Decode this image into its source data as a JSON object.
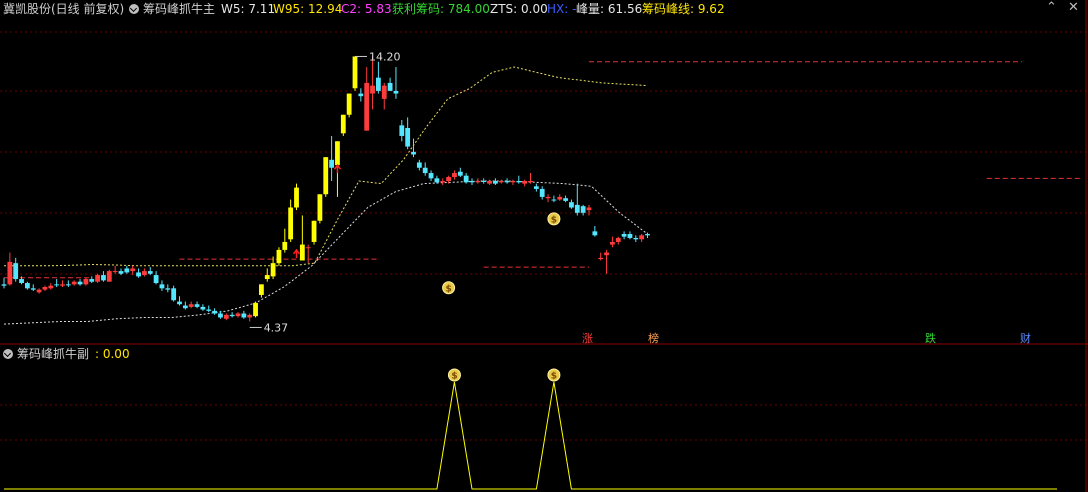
{
  "main_panel": {
    "title": "冀凯股份(日线 前复权)",
    "indicator_name": "筹码峰抓牛主",
    "items": [
      {
        "label": "W5: 7.11",
        "color": "#e6e6e6"
      },
      {
        "label": "W95: 12.94",
        "color": "#ffe600"
      },
      {
        "label": "C2: 5.83",
        "color": "#ff40ff"
      },
      {
        "label": "获利筹码: 784.00",
        "color": "#34d634"
      },
      {
        "label": "ZTS: 0.00",
        "color": "#e6e6e6"
      },
      {
        "label": "HX: -",
        "color": "#3a5cff"
      },
      {
        "label": "峰量: 61.56",
        "color": "#e6e6e6"
      },
      {
        "label": "筹码峰线: 9.62",
        "color": "#ffe600"
      }
    ],
    "price_high_label": "14.20",
    "price_low_label": "4.37",
    "events": [
      {
        "text": "涨",
        "color": "#ff3c3c"
      },
      {
        "text": "榜",
        "color": "#ffa050"
      },
      {
        "text": "跌",
        "color": "#34d634"
      },
      {
        "text": "财",
        "color": "#5a8cff"
      }
    ]
  },
  "sub_panel": {
    "title": "筹码峰抓牛副",
    "value_label": ": 0.00"
  },
  "chart_data": {
    "type": "candlestick",
    "price_range": [
      3.5,
      15.5
    ],
    "up_color": "#ff3c3c",
    "down_color": "#55e6ff",
    "signal_color": "#ffff00",
    "candles": [
      {
        "o": 5.6,
        "h": 5.85,
        "l": 5.45,
        "c": 5.55,
        "k": "d"
      },
      {
        "o": 5.6,
        "h": 6.8,
        "l": 5.55,
        "c": 6.45,
        "k": "u"
      },
      {
        "o": 6.4,
        "h": 6.6,
        "l": 5.7,
        "c": 5.8,
        "k": "d"
      },
      {
        "o": 5.8,
        "h": 5.9,
        "l": 5.6,
        "c": 5.65,
        "k": "d"
      },
      {
        "o": 5.65,
        "h": 5.7,
        "l": 5.4,
        "c": 5.45,
        "k": "d"
      },
      {
        "o": 5.45,
        "h": 5.6,
        "l": 5.35,
        "c": 5.4,
        "k": "d"
      },
      {
        "o": 5.3,
        "h": 5.45,
        "l": 5.25,
        "c": 5.4,
        "k": "u"
      },
      {
        "o": 5.4,
        "h": 5.55,
        "l": 5.35,
        "c": 5.5,
        "k": "u"
      },
      {
        "o": 5.45,
        "h": 5.65,
        "l": 5.4,
        "c": 5.55,
        "k": "u"
      },
      {
        "o": 5.6,
        "h": 5.8,
        "l": 5.5,
        "c": 5.6,
        "k": "d"
      },
      {
        "o": 5.55,
        "h": 5.75,
        "l": 5.5,
        "c": 5.6,
        "k": "u"
      },
      {
        "o": 5.6,
        "h": 5.75,
        "l": 5.5,
        "c": 5.6,
        "k": "d"
      },
      {
        "o": 5.6,
        "h": 5.75,
        "l": 5.55,
        "c": 5.7,
        "k": "u"
      },
      {
        "o": 5.7,
        "h": 5.8,
        "l": 5.55,
        "c": 5.6,
        "k": "d"
      },
      {
        "o": 5.6,
        "h": 5.85,
        "l": 5.55,
        "c": 5.8,
        "k": "u"
      },
      {
        "o": 5.8,
        "h": 5.9,
        "l": 5.65,
        "c": 5.7,
        "k": "d"
      },
      {
        "o": 5.7,
        "h": 6.0,
        "l": 5.65,
        "c": 5.95,
        "k": "u"
      },
      {
        "o": 5.95,
        "h": 6.1,
        "l": 5.7,
        "c": 5.75,
        "k": "d"
      },
      {
        "o": 5.7,
        "h": 6.15,
        "l": 5.7,
        "c": 6.1,
        "k": "u"
      },
      {
        "o": 6.1,
        "h": 6.3,
        "l": 6.0,
        "c": 6.1,
        "k": "u"
      },
      {
        "o": 6.1,
        "h": 6.2,
        "l": 5.95,
        "c": 6.0,
        "k": "d"
      },
      {
        "o": 6.05,
        "h": 6.3,
        "l": 6.0,
        "c": 6.2,
        "k": "d"
      },
      {
        "o": 6.2,
        "h": 6.3,
        "l": 5.95,
        "c": 6.1,
        "k": "u"
      },
      {
        "o": 6.05,
        "h": 6.2,
        "l": 5.85,
        "c": 5.9,
        "k": "d"
      },
      {
        "o": 5.95,
        "h": 6.2,
        "l": 5.9,
        "c": 6.1,
        "k": "u"
      },
      {
        "o": 6.1,
        "h": 6.25,
        "l": 5.95,
        "c": 6.0,
        "k": "d"
      },
      {
        "o": 5.95,
        "h": 6.1,
        "l": 5.6,
        "c": 5.65,
        "k": "d"
      },
      {
        "o": 5.6,
        "h": 5.75,
        "l": 5.35,
        "c": 5.45,
        "k": "d"
      },
      {
        "o": 5.45,
        "h": 5.6,
        "l": 5.3,
        "c": 5.4,
        "k": "d"
      },
      {
        "o": 5.45,
        "h": 5.55,
        "l": 4.95,
        "c": 5.0,
        "k": "d"
      },
      {
        "o": 4.95,
        "h": 5.15,
        "l": 4.8,
        "c": 4.85,
        "k": "d"
      },
      {
        "o": 4.8,
        "h": 4.95,
        "l": 4.65,
        "c": 4.7,
        "k": "d"
      },
      {
        "o": 4.75,
        "h": 4.95,
        "l": 4.7,
        "c": 4.85,
        "k": "u"
      },
      {
        "o": 4.85,
        "h": 4.95,
        "l": 4.7,
        "c": 4.75,
        "k": "d"
      },
      {
        "o": 4.75,
        "h": 4.85,
        "l": 4.6,
        "c": 4.65,
        "k": "d"
      },
      {
        "o": 4.65,
        "h": 4.8,
        "l": 4.55,
        "c": 4.6,
        "k": "d"
      },
      {
        "o": 4.6,
        "h": 4.7,
        "l": 4.45,
        "c": 4.5,
        "k": "d"
      },
      {
        "o": 4.5,
        "h": 4.6,
        "l": 4.3,
        "c": 4.35,
        "k": "d"
      },
      {
        "o": 4.3,
        "h": 4.5,
        "l": 4.25,
        "c": 4.45,
        "k": "u"
      },
      {
        "o": 4.45,
        "h": 4.55,
        "l": 4.35,
        "c": 4.4,
        "k": "d"
      },
      {
        "o": 4.4,
        "h": 4.55,
        "l": 4.35,
        "c": 4.5,
        "k": "u"
      },
      {
        "o": 4.5,
        "h": 4.6,
        "l": 4.3,
        "c": 4.35,
        "k": "d"
      },
      {
        "o": 4.35,
        "h": 4.5,
        "l": 4.2,
        "c": 4.45,
        "k": "u"
      },
      {
        "o": 4.4,
        "h": 4.95,
        "l": 4.35,
        "c": 4.9,
        "k": "s"
      },
      {
        "o": 5.2,
        "h": 5.6,
        "l": 5.1,
        "c": 5.6,
        "k": "s"
      },
      {
        "o": 5.8,
        "h": 6.2,
        "l": 5.7,
        "c": 5.95,
        "k": "s"
      },
      {
        "o": 5.9,
        "h": 6.65,
        "l": 5.8,
        "c": 6.4,
        "k": "s"
      },
      {
        "o": 6.4,
        "h": 7.0,
        "l": 6.3,
        "c": 6.9,
        "k": "s"
      },
      {
        "o": 6.9,
        "h": 7.7,
        "l": 6.8,
        "c": 7.2,
        "k": "s"
      },
      {
        "o": 7.3,
        "h": 8.8,
        "l": 7.2,
        "c": 8.5,
        "k": "s"
      },
      {
        "o": 8.5,
        "h": 9.4,
        "l": 8.4,
        "c": 9.25,
        "k": "s"
      },
      {
        "o": 6.5,
        "h": 8.2,
        "l": 6.5,
        "c": 7.1,
        "k": "s"
      },
      {
        "o": 7.0,
        "h": 7.1,
        "l": 6.4,
        "c": 7.0,
        "k": "u"
      },
      {
        "o": 7.2,
        "h": 8.0,
        "l": 7.1,
        "c": 8.0,
        "k": "s"
      },
      {
        "o": 8.0,
        "h": 9.0,
        "l": 7.9,
        "c": 9.0,
        "k": "s"
      },
      {
        "o": 9.0,
        "h": 10.4,
        "l": 8.9,
        "c": 10.4,
        "k": "s"
      },
      {
        "o": 10.0,
        "h": 11.2,
        "l": 9.5,
        "c": 10.3,
        "k": "d"
      },
      {
        "o": 10.1,
        "h": 11.0,
        "l": 8.9,
        "c": 11.0,
        "k": "s"
      },
      {
        "o": 11.3,
        "h": 12.0,
        "l": 11.2,
        "c": 12.0,
        "k": "s"
      },
      {
        "o": 12.0,
        "h": 12.8,
        "l": 11.9,
        "c": 12.8,
        "k": "s"
      },
      {
        "o": 13.0,
        "h": 14.2,
        "l": 12.9,
        "c": 14.2,
        "k": "s"
      },
      {
        "o": 12.8,
        "h": 13.0,
        "l": 12.5,
        "c": 12.7,
        "k": "d"
      },
      {
        "o": 11.4,
        "h": 13.8,
        "l": 11.4,
        "c": 13.2,
        "k": "u"
      },
      {
        "o": 12.8,
        "h": 14.2,
        "l": 12.2,
        "c": 13.1,
        "k": "u"
      },
      {
        "o": 13.4,
        "h": 14.0,
        "l": 12.8,
        "c": 12.9,
        "k": "d"
      },
      {
        "o": 12.6,
        "h": 13.2,
        "l": 12.2,
        "c": 13.1,
        "k": "u"
      },
      {
        "o": 13.2,
        "h": 13.4,
        "l": 12.9,
        "c": 12.9,
        "k": "d"
      },
      {
        "o": 12.9,
        "h": 13.8,
        "l": 12.6,
        "c": 12.8,
        "k": "d"
      },
      {
        "o": 11.6,
        "h": 11.8,
        "l": 11.0,
        "c": 11.2,
        "k": "d"
      },
      {
        "o": 11.5,
        "h": 11.9,
        "l": 10.7,
        "c": 10.8,
        "k": "d"
      },
      {
        "o": 10.6,
        "h": 11.1,
        "l": 10.4,
        "c": 10.5,
        "k": "d"
      },
      {
        "o": 10.2,
        "h": 10.3,
        "l": 9.9,
        "c": 10.0,
        "k": "d"
      },
      {
        "o": 10.0,
        "h": 10.2,
        "l": 9.7,
        "c": 9.8,
        "k": "d"
      },
      {
        "o": 9.8,
        "h": 9.9,
        "l": 9.5,
        "c": 9.6,
        "k": "d"
      },
      {
        "o": 9.6,
        "h": 9.7,
        "l": 9.4,
        "c": 9.45,
        "k": "d"
      },
      {
        "o": 9.45,
        "h": 9.6,
        "l": 9.35,
        "c": 9.5,
        "k": "u"
      },
      {
        "o": 9.5,
        "h": 9.7,
        "l": 9.4,
        "c": 9.65,
        "k": "u"
      },
      {
        "o": 9.65,
        "h": 9.9,
        "l": 9.55,
        "c": 9.8,
        "k": "u"
      },
      {
        "o": 9.85,
        "h": 10.0,
        "l": 9.65,
        "c": 9.7,
        "k": "d"
      },
      {
        "o": 9.7,
        "h": 9.8,
        "l": 9.4,
        "c": 9.45,
        "k": "d"
      },
      {
        "o": 9.5,
        "h": 9.6,
        "l": 9.35,
        "c": 9.45,
        "k": "d"
      },
      {
        "o": 9.45,
        "h": 9.6,
        "l": 9.4,
        "c": 9.5,
        "k": "u"
      },
      {
        "o": 9.5,
        "h": 9.6,
        "l": 9.4,
        "c": 9.5,
        "k": "d"
      },
      {
        "o": 9.4,
        "h": 9.55,
        "l": 9.35,
        "c": 9.5,
        "k": "u"
      },
      {
        "o": 9.5,
        "h": 9.6,
        "l": 9.35,
        "c": 9.4,
        "k": "d"
      },
      {
        "o": 9.45,
        "h": 9.55,
        "l": 9.4,
        "c": 9.5,
        "k": "u"
      },
      {
        "o": 9.5,
        "h": 9.6,
        "l": 9.4,
        "c": 9.45,
        "k": "d"
      },
      {
        "o": 9.45,
        "h": 9.55,
        "l": 9.35,
        "c": 9.5,
        "k": "u"
      },
      {
        "o": 9.5,
        "h": 9.7,
        "l": 9.4,
        "c": 9.45,
        "k": "d"
      },
      {
        "o": 9.4,
        "h": 9.55,
        "l": 9.3,
        "c": 9.5,
        "k": "u"
      },
      {
        "o": 9.5,
        "h": 9.8,
        "l": 9.4,
        "c": 9.5,
        "k": "u"
      },
      {
        "o": 9.3,
        "h": 9.4,
        "l": 9.1,
        "c": 9.2,
        "k": "d"
      },
      {
        "o": 9.2,
        "h": 9.3,
        "l": 8.8,
        "c": 8.9,
        "k": "d"
      },
      {
        "o": 8.9,
        "h": 9.0,
        "l": 8.7,
        "c": 8.85,
        "k": "u"
      },
      {
        "o": 8.8,
        "h": 8.95,
        "l": 8.7,
        "c": 8.8,
        "k": "d"
      },
      {
        "o": 8.8,
        "h": 9.0,
        "l": 8.75,
        "c": 8.9,
        "k": "u"
      },
      {
        "o": 8.85,
        "h": 8.95,
        "l": 8.7,
        "c": 8.75,
        "k": "d"
      },
      {
        "o": 8.7,
        "h": 8.8,
        "l": 8.45,
        "c": 8.5,
        "k": "d"
      },
      {
        "o": 8.6,
        "h": 9.4,
        "l": 8.2,
        "c": 8.3,
        "k": "d"
      },
      {
        "o": 8.3,
        "h": 8.6,
        "l": 8.2,
        "c": 8.55,
        "k": "d"
      },
      {
        "o": 8.5,
        "h": 8.6,
        "l": 8.2,
        "c": 8.4,
        "k": "u"
      },
      {
        "o": 7.6,
        "h": 7.8,
        "l": 7.4,
        "c": 7.45,
        "k": "d"
      },
      {
        "o": 6.6,
        "h": 6.8,
        "l": 6.5,
        "c": 6.55,
        "k": "u"
      },
      {
        "o": 6.7,
        "h": 6.9,
        "l": 6.0,
        "c": 6.8,
        "k": "u"
      },
      {
        "o": 7.1,
        "h": 7.4,
        "l": 7.0,
        "c": 7.2,
        "k": "u"
      },
      {
        "o": 7.2,
        "h": 7.4,
        "l": 7.1,
        "c": 7.35,
        "k": "u"
      },
      {
        "o": 7.4,
        "h": 7.6,
        "l": 7.3,
        "c": 7.5,
        "k": "d"
      },
      {
        "o": 7.5,
        "h": 7.6,
        "l": 7.3,
        "c": 7.35,
        "k": "d"
      },
      {
        "o": 7.35,
        "h": 7.45,
        "l": 7.2,
        "c": 7.3,
        "k": "d"
      },
      {
        "o": 7.3,
        "h": 7.5,
        "l": 7.2,
        "c": 7.45,
        "k": "u"
      },
      {
        "o": 7.45,
        "h": 7.55,
        "l": 7.35,
        "c": 7.5,
        "k": "d"
      }
    ],
    "support_line": [
      4.1,
      4.15,
      4.2,
      4.2,
      4.3,
      4.35,
      4.35,
      4.45,
      4.6,
      4.9,
      5.5,
      6.3,
      7.4,
      8.5,
      9.1,
      9.4,
      9.45,
      9.5,
      9.5,
      9.45,
      9.4,
      9.3,
      8.3,
      7.5
    ],
    "peak_line": [
      6.3,
      6.3,
      6.3,
      6.32,
      6.35,
      6.33,
      6.3,
      6.3,
      6.3,
      6.3,
      6.3,
      6.3,
      6.3,
      6.3,
      6.4,
      8.0,
      9.5,
      9.4,
      10.3,
      11.5,
      12.6,
      13.0,
      13.6,
      13.8,
      13.6,
      13.4,
      13.3,
      13.2,
      13.15,
      13.1
    ],
    "resistance_levels": [
      {
        "value": 5.85,
        "from": 0,
        "to": 15
      },
      {
        "value": 6.55,
        "from": 30,
        "to": 64
      },
      {
        "value": 6.25,
        "from": 82,
        "to": 100
      },
      {
        "value": 14.0,
        "from": 100,
        "to": 174
      },
      {
        "value": 9.6,
        "from": 168,
        "to": 184
      }
    ],
    "signals_main": [
      {
        "type": "money",
        "at": 76,
        "value": 6.0
      },
      {
        "type": "money",
        "at": 94,
        "value": 8.6
      }
    ],
    "sub_series": {
      "type": "line",
      "values_at": [
        {
          "x": 0,
          "v": 0
        },
        {
          "x": 74,
          "v": 0
        },
        {
          "x": 77,
          "v": 1
        },
        {
          "x": 80,
          "v": 0
        },
        {
          "x": 91,
          "v": 0
        },
        {
          "x": 94,
          "v": 1
        },
        {
          "x": 97,
          "v": 0
        },
        {
          "x": 180,
          "v": 0
        }
      ],
      "signals": [
        {
          "type": "money",
          "at": 77
        },
        {
          "type": "money",
          "at": 94
        }
      ],
      "ylim": [
        0,
        1
      ]
    }
  }
}
